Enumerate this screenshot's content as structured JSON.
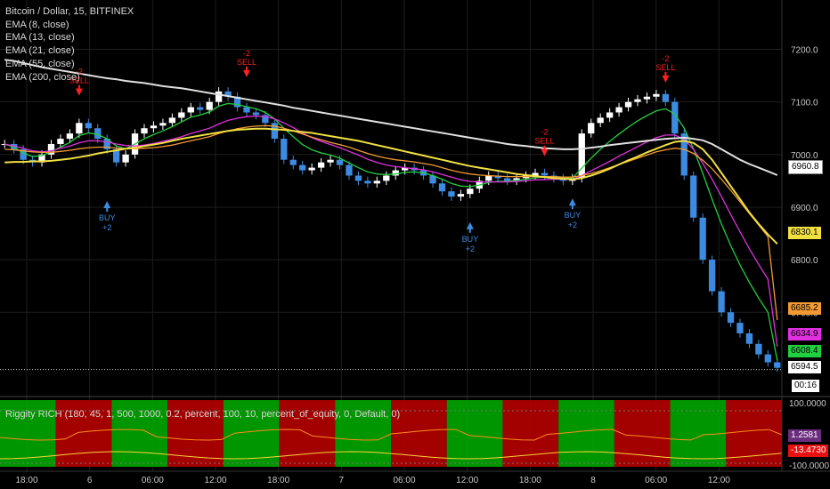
{
  "legend": {
    "title": "Bitcoin / Dollar, 15, BITFINEX",
    "ema_labels": [
      "EMA (8, close)",
      "EMA (13, close)",
      "EMA (21, close)",
      "EMA (55, close)",
      "EMA (200, close)"
    ]
  },
  "study_label": "Riggity RICH (180, 45, 1, 500, 1000, 0.2, percent, 100, 10, percent_of_equity, 0, Default, 0)",
  "price_axis": {
    "ticks": [
      "7200.0",
      "7100.0",
      "7000.0",
      "6900.0",
      "6800.0",
      "6700.0"
    ],
    "tags": {
      "ema200": "6960.8",
      "ema55": "6830.1",
      "ema21": "6685.2",
      "ema13": "6634.9",
      "ema8": "6608.4",
      "last": "6594.5",
      "timer": "00:16"
    }
  },
  "study_axis": {
    "ticks": [
      "100.0000",
      "-100.0000"
    ],
    "tags": {
      "value1": "1.2581",
      "value2": "-13.4730"
    }
  },
  "time_axis": [
    "18:00",
    "6",
    "06:00",
    "12:00",
    "18:00",
    "7",
    "06:00",
    "12:00",
    "18:00",
    "8",
    "06:00",
    "12:00"
  ],
  "signals": [
    {
      "type": "sell",
      "qty": "-2",
      "label": "SELL"
    },
    {
      "type": "buy",
      "qty": "+2",
      "label": "BUY"
    },
    {
      "type": "sell",
      "qty": "-2",
      "label": "SELL"
    },
    {
      "type": "buy",
      "qty": "+2",
      "label": "BUY"
    },
    {
      "type": "sell",
      "qty": "-2",
      "label": "SELL"
    },
    {
      "type": "buy",
      "qty": "+2",
      "label": "BUY"
    },
    {
      "type": "sell",
      "qty": "-2",
      "label": "SELL"
    }
  ],
  "colors": {
    "background": "#000000",
    "candle_up": "#ffffff",
    "candle_down": "#3d8be0",
    "ema8": "#20d040",
    "ema13": "#e030e0",
    "ema21": "#f39a33",
    "ema55": "#f0e040",
    "ema200": "#e0e0e0",
    "buy": "#3d8be0",
    "sell": "#ff2020",
    "study_green": "#00b000",
    "study_red": "#c00000"
  },
  "chart_data": {
    "type": "line",
    "symbol": "BTCUSD",
    "ylim": [
      6550,
      7260
    ],
    "x_ticks": [
      "18:00",
      "6",
      "06:00",
      "12:00",
      "18:00",
      "7",
      "06:00",
      "12:00",
      "18:00",
      "8",
      "06:00",
      "12:00"
    ],
    "close": [
      7020,
      7010,
      6990,
      6985,
      7000,
      7020,
      7030,
      7040,
      7060,
      7050,
      7030,
      7010,
      6985,
      7000,
      7040,
      7050,
      7055,
      7060,
      7070,
      7080,
      7090,
      7085,
      7100,
      7120,
      7110,
      7090,
      7080,
      7075,
      7060,
      7030,
      6990,
      6980,
      6970,
      6975,
      6985,
      6990,
      6980,
      6960,
      6950,
      6945,
      6950,
      6960,
      6970,
      6975,
      6970,
      6960,
      6945,
      6930,
      6920,
      6925,
      6935,
      6950,
      6960,
      6955,
      6950,
      6955,
      6960,
      6965,
      6960,
      6955,
      6950,
      6955,
      7040,
      7060,
      7070,
      7080,
      7090,
      7100,
      7105,
      7110,
      7115,
      7100,
      7040,
      6960,
      6880,
      6800,
      6740,
      6700,
      6680,
      6660,
      6640,
      6620,
      6605,
      6594.5
    ],
    "series": [
      {
        "name": "EMA (8, close)",
        "values": [
          7020,
          7014,
          7003,
          6996,
          6998,
          7005,
          7014,
          7023,
          7036,
          7041,
          7038,
          7030,
          7016,
          7011,
          7020,
          7030,
          7038,
          7045,
          7053,
          7062,
          7071,
          7075,
          7081,
          7092,
          7097,
          7095,
          7091,
          7087,
          7080,
          7068,
          7050,
          7034,
          7019,
          7009,
          7003,
          6999,
          6993,
          6984,
          6975,
          6967,
          6963,
          6962,
          6963,
          6966,
          6967,
          6965,
          6960,
          6953,
          6945,
          6940,
          6939,
          6942,
          6947,
          6949,
          6949,
          6951,
          6953,
          6956,
          6957,
          6957,
          6955,
          6955,
          6974,
          6993,
          7010,
          7025,
          7039,
          7052,
          7064,
          7074,
          7083,
          7087,
          7077,
          7050,
          7011,
          6964,
          6915,
          6868,
          6827,
          6790,
          6757,
          6727,
          6700,
          6608.4
        ]
      },
      {
        "name": "EMA (13, close)",
        "values": [
          7020,
          7016,
          7012,
          7007,
          7005,
          7007,
          7012,
          7016,
          7022,
          7026,
          7026,
          7024,
          7020,
          7017,
          7016,
          7018,
          7021,
          7025,
          7029,
          7034,
          7040,
          7045,
          7050,
          7058,
          7065,
          7069,
          7072,
          7073,
          7072,
          7068,
          7060,
          7051,
          7041,
          7032,
          7025,
          7019,
          7013,
          7006,
          6999,
          6991,
          6985,
          6980,
          6977,
          6975,
          6973,
          6971,
          6967,
          6962,
          6957,
          6952,
          6949,
          6948,
          6948,
          6948,
          6948,
          6949,
          6950,
          6952,
          6952,
          6953,
          6953,
          6953,
          6960,
          6969,
          6978,
          6987,
          6997,
          7006,
          7015,
          7024,
          7032,
          7037,
          7037,
          7029,
          7010,
          6983,
          6953,
          6920,
          6886,
          6853,
          6821,
          6791,
          6763,
          6634.9
        ]
      },
      {
        "name": "EMA (21, close)",
        "values": [
          7010,
          7009,
          7007,
          7005,
          7004,
          7004,
          7006,
          7008,
          7011,
          7013,
          7014,
          7014,
          7012,
          7011,
          7011,
          7012,
          7013,
          7015,
          7018,
          7022,
          7026,
          7030,
          7034,
          7040,
          7045,
          7049,
          7052,
          7054,
          7055,
          7054,
          7050,
          7045,
          7039,
          7033,
          7028,
          7023,
          7019,
          7014,
          7008,
          7002,
          6997,
          6993,
          6990,
          6988,
          6986,
          6983,
          6980,
          6975,
          6970,
          6966,
          6963,
          6961,
          6960,
          6959,
          6958,
          6958,
          6958,
          6958,
          6958,
          6958,
          6957,
          6957,
          6960,
          6964,
          6969,
          6975,
          6981,
          6987,
          6993,
          6999,
          7005,
          7009,
          7012,
          7010,
          7002,
          6989,
          6973,
          6953,
          6932,
          6910,
          6888,
          6866,
          6844,
          6685.2
        ]
      },
      {
        "name": "EMA (55, close)",
        "values": [
          6985,
          6986,
          6986,
          6987,
          6987,
          6988,
          6990,
          6992,
          6995,
          6998,
          7002,
          7005,
          7008,
          7011,
          7013,
          7016,
          7019,
          7022,
          7026,
          7030,
          7033,
          7036,
          7039,
          7042,
          7045,
          7047,
          7048,
          7049,
          7049,
          7048,
          7047,
          7045,
          7043,
          7041,
          7038,
          7035,
          7032,
          7029,
          7026,
          7022,
          7018,
          7014,
          7010,
          7006,
          7002,
          6998,
          6994,
          6990,
          6986,
          6982,
          6978,
          6975,
          6972,
          6969,
          6966,
          6963,
          6961,
          6959,
          6957,
          6955,
          6954,
          6953,
          6955,
          6960,
          6966,
          6973,
          6981,
          6989,
          6996,
          7004,
          7011,
          7018,
          7024,
          7026,
          7022,
          7010,
          6990,
          6965,
          6940,
          6915,
          6890,
          6868,
          6848,
          6830.1
        ]
      },
      {
        "name": "EMA (200, close)",
        "values": [
          7180,
          7178,
          7174,
          7170,
          7166,
          7163,
          7160,
          7157,
          7154,
          7151,
          7148,
          7145,
          7143,
          7140,
          7138,
          7136,
          7133,
          7130,
          7128,
          7126,
          7123,
          7120,
          7117,
          7114,
          7111,
          7108,
          7105,
          7102,
          7099,
          7096,
          7093,
          7089,
          7086,
          7083,
          7080,
          7077,
          7074,
          7071,
          7068,
          7065,
          7062,
          7059,
          7056,
          7053,
          7050,
          7047,
          7044,
          7041,
          7038,
          7035,
          7032,
          7029,
          7026,
          7023,
          7020,
          7018,
          7016,
          7014,
          7012,
          7011,
          7010,
          7010,
          7011,
          7013,
          7015,
          7018,
          7020,
          7022,
          7024,
          7026,
          7028,
          7030,
          7031,
          7032,
          7030,
          7027,
          7020,
          7010,
          7000,
          6990,
          6982,
          6975,
          6968,
          6960.8
        ]
      }
    ],
    "buy_sell": [
      {
        "type": "sell",
        "price": 7095,
        "label": "-2 SELL"
      },
      {
        "type": "buy",
        "price": 6925,
        "label": "BUY +2"
      },
      {
        "type": "sell",
        "price": 7130,
        "label": "-2 SELL"
      },
      {
        "type": "buy",
        "price": 6885,
        "label": "BUY +2"
      },
      {
        "type": "sell",
        "price": 6980,
        "label": "-2 SELL"
      },
      {
        "type": "buy",
        "price": 6930,
        "label": "BUY +2"
      },
      {
        "type": "sell",
        "price": 7120,
        "label": "-2 SELL"
      }
    ],
    "study": {
      "range": [
        -100,
        100
      ],
      "zones": [
        "green",
        "red",
        "green",
        "red",
        "green",
        "red",
        "green",
        "red",
        "green",
        "red",
        "green",
        "red",
        "green",
        "red"
      ],
      "last_values": [
        1.2581,
        -13.473
      ]
    }
  }
}
